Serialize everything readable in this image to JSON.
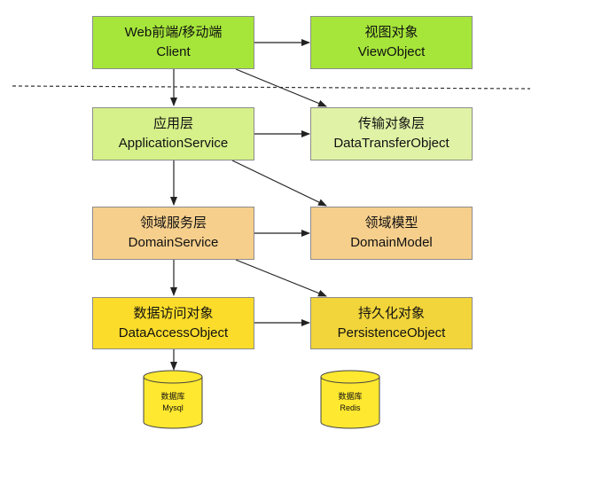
{
  "colors": {
    "client": "#a6e63a",
    "view": "#a6e63a",
    "application": "#d6f08a",
    "transfer": "#e0f2a6",
    "domain": "#f6cf8c",
    "domain_model": "#f6cf8c",
    "dao": "#fbdc2a",
    "persistence": "#f2d53a",
    "database": "#ffe830",
    "line": "#222222"
  },
  "nodes": {
    "client": {
      "title": "Web前端/移动端",
      "subtitle": "Client"
    },
    "view_object": {
      "title": "视图对象",
      "subtitle": "ViewObject"
    },
    "application_service": {
      "title": "应用层",
      "subtitle": "ApplicationService"
    },
    "data_transfer_object": {
      "title": "传输对象层",
      "subtitle": "DataTransferObject"
    },
    "domain_service": {
      "title": "领域服务层",
      "subtitle": "DomainService"
    },
    "domain_model": {
      "title": "领域模型",
      "subtitle": "DomainModel"
    },
    "data_access_object": {
      "title": "数据访问对象",
      "subtitle": "DataAccessObject"
    },
    "persistence_object": {
      "title": "持久化对象",
      "subtitle": "PersistenceObject"
    },
    "db_mysql": {
      "title": "数据库",
      "subtitle": "Mysql"
    },
    "db_redis": {
      "title": "数据库",
      "subtitle": "Redis"
    }
  }
}
